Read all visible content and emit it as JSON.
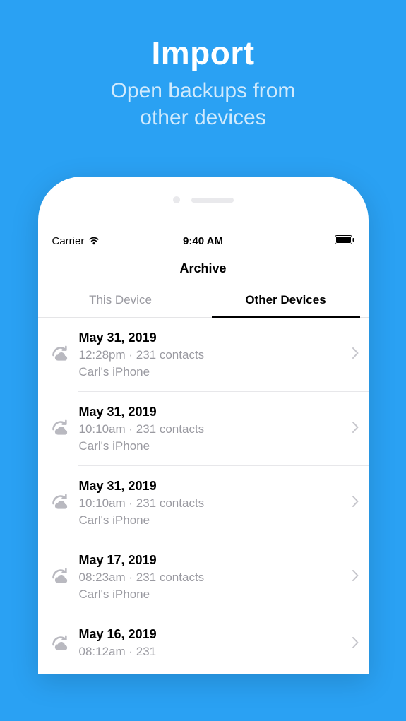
{
  "hero": {
    "title": "Import",
    "subtitle_line1": "Open backups from",
    "subtitle_line2": "other devices"
  },
  "status": {
    "carrier": "Carrier",
    "time": "9:40 AM"
  },
  "nav": {
    "title": "Archive"
  },
  "tabs": {
    "this_device": "This Device",
    "other_devices": "Other Devices",
    "active": "other_devices"
  },
  "backups": [
    {
      "date": "May 31, 2019",
      "meta": "12:28pm · 231 contacts",
      "device": "Carl's iPhone"
    },
    {
      "date": "May 31, 2019",
      "meta": "10:10am · 231 contacts",
      "device": "Carl's iPhone"
    },
    {
      "date": "May 31, 2019",
      "meta": "10:10am · 231 contacts",
      "device": "Carl's iPhone"
    },
    {
      "date": "May 17, 2019",
      "meta": "08:23am · 231 contacts",
      "device": "Carl's iPhone"
    },
    {
      "date": "May 16, 2019",
      "meta": "08:12am · 231",
      "device": ""
    }
  ]
}
